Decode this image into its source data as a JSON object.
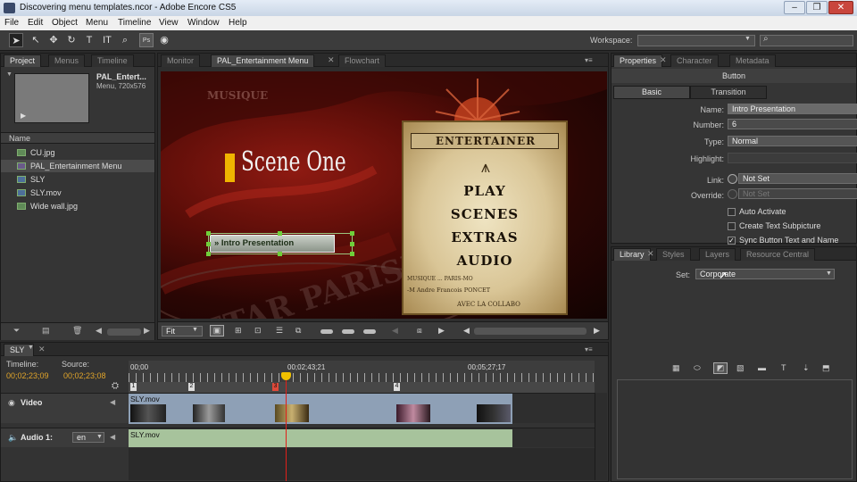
{
  "window": {
    "title": "Discovering menu templates.ncor - Adobe Encore CS5"
  },
  "menu": [
    "File",
    "Edit",
    "Object",
    "Menu",
    "Timeline",
    "View",
    "Window",
    "Help"
  ],
  "toolbar": {
    "workspace_label": "Workspace:",
    "workspace_value": "",
    "search_value": ""
  },
  "project": {
    "tabs": [
      "Project",
      "Menus",
      "Timeline"
    ],
    "preview_name": "PAL_Entert...",
    "preview_info": "Menu, 720x576",
    "name_header": "Name",
    "files": [
      {
        "name": "CU.jpg",
        "kind": "image"
      },
      {
        "name": "PAL_Entertainment Menu",
        "kind": "menu"
      },
      {
        "name": "SLY",
        "kind": "timeline"
      },
      {
        "name": "SLY.mov",
        "kind": "video"
      },
      {
        "name": "Wide wall.jpg",
        "kind": "image"
      }
    ]
  },
  "viewer": {
    "tabs": [
      "Monitor",
      "PAL_Entertainment Menu",
      "Flowchart"
    ],
    "zoom": "Fit",
    "menu_art": {
      "top_text": "MUSIQUE",
      "scene_title": "Scene One",
      "button_label": "» Intro Presentation",
      "poster_title": "ENTERTAINER",
      "poster_items": [
        "PLAY",
        "SCENES",
        "EXTRAS",
        "AUDIO"
      ],
      "poster_footer1": "MUSIQUE ... PARIS-MO",
      "poster_footer2": "-M Andre Francois PONCET",
      "poster_footer3": "AVEC LA COLLABO"
    }
  },
  "properties": {
    "tabs": [
      "Properties",
      "Character",
      "Metadata"
    ],
    "type_heading": "Button",
    "subtabs": [
      "Basic",
      "Transition"
    ],
    "name_label": "Name:",
    "name_value": "Intro Presentation",
    "number_label": "Number:",
    "number_value": "6",
    "type_label": "Type:",
    "type_value": "Normal",
    "highlight_label": "Highlight:",
    "link_label": "Link:",
    "link_value": "Not Set",
    "override_label": "Override:",
    "override_value": "Not Set",
    "checks": [
      {
        "label": "Auto Activate",
        "checked": false
      },
      {
        "label": "Create Text Subpicture",
        "checked": false
      },
      {
        "label": "Sync Button Text and Name",
        "checked": true
      }
    ]
  },
  "library": {
    "tabs": [
      "Library",
      "Styles",
      "Layers",
      "Resource Central"
    ],
    "set_label": "Set:",
    "set_value": "Corporate"
  },
  "timeline": {
    "tab": "SLY",
    "timeline_label": "Timeline:",
    "timeline_time": "00;02;23;09",
    "source_label": "Source:",
    "source_time": "00;02;23;08",
    "ruler": [
      "00;00",
      "00;02;43;21",
      "00;05;27;17"
    ],
    "chapters": [
      "1",
      "2",
      "3",
      "4"
    ],
    "video_label": "Video",
    "video_clip": "SLY.mov",
    "audio_label": "Audio 1:",
    "audio_lang": "en",
    "audio_clip": "SLY.mov",
    "playhead_fraction": 0.44
  }
}
